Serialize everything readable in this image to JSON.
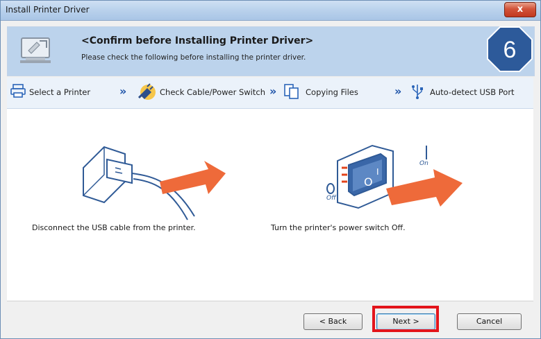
{
  "window": {
    "title": "Install Printer Driver",
    "close_glyph": "x"
  },
  "header": {
    "title": "<Confirm before Installing Printer Driver>",
    "subtitle": "Please check the following before installing the printer driver.",
    "step_badge": "6"
  },
  "steps": [
    {
      "label": "Select a Printer",
      "icon": "printer-icon"
    },
    {
      "label": "Check Cable/Power Switch",
      "icon": "plug-icon"
    },
    {
      "label": "Copying Files",
      "icon": "copy-files-icon"
    },
    {
      "label": "Auto-detect USB Port",
      "icon": "usb-icon"
    }
  ],
  "instructions": {
    "usb_caption": "Disconnect the USB cable from the printer.",
    "power_caption": "Turn the printer's power switch Off.",
    "switch_on_label": "On",
    "switch_off_label": "Off"
  },
  "buttons": {
    "back": "< Back",
    "next": "Next >",
    "cancel": "Cancel"
  },
  "colors": {
    "accent": "#2d5a9a",
    "highlight": "#e3141b",
    "arrow": "#ee6a3a"
  }
}
